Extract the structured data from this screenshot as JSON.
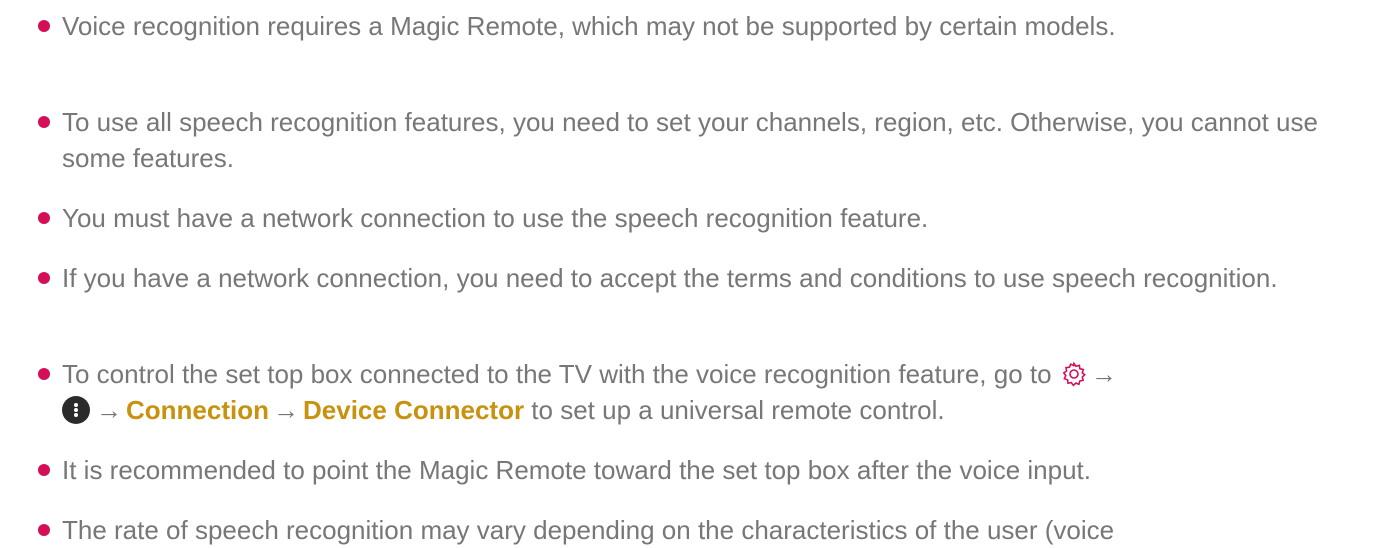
{
  "notes": [
    {
      "text": "Voice recognition requires a Magic Remote, which may not be supported by certain models."
    },
    {
      "text": "To use all speech recognition features, you need to set your channels, region, etc. Otherwise, you cannot use some features."
    },
    {
      "text": "You must have a network connection to use the speech recognition feature."
    },
    {
      "text": "If you have a network connection, you need to accept the terms and conditions to use speech recognition."
    },
    {
      "text_before": "To control the set top box connected to the TV with the voice recognition feature, go to ",
      "arrow": "→",
      "menu_path": [
        "Connection",
        "Device Connector"
      ],
      "text_after": " to set up a universal remote control."
    },
    {
      "text": "It is recommended to point the Magic Remote toward the set top box after the voice input."
    },
    {
      "text": "The rate of speech recognition may vary depending on the characteristics of the user (voice"
    }
  ],
  "icons": {
    "settings": "gear-icon",
    "more": "more-vertical-icon"
  },
  "colors": {
    "bullet": "#d40f58",
    "highlight": "#c8920e",
    "text": "#777777"
  }
}
